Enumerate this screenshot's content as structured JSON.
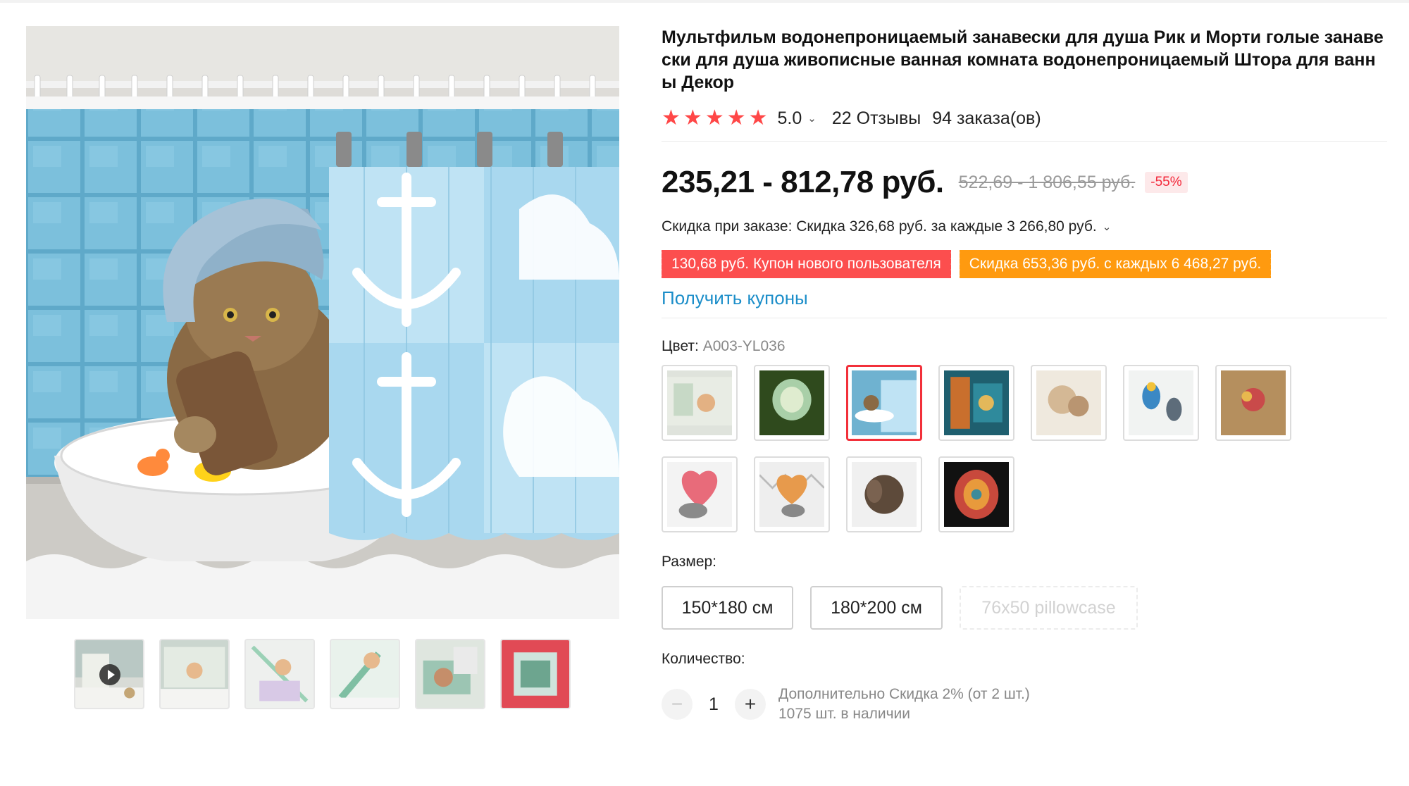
{
  "product": {
    "title": "Мультфильм водонепроницаемый занавески для душа Рик и Морти голые занавески для душа живописные ванная комната водонепроницаемый Штора для ванны Декор"
  },
  "rating": {
    "stars": 5,
    "value": "5.0",
    "reviews": "22 Отзывы",
    "orders": "94 заказа(ов)"
  },
  "price": {
    "current": "235,21 - 812,78 руб.",
    "original": "522,69 - 1 806,55 руб.",
    "discount": "-55%"
  },
  "bulk_discount": "Скидка при заказе: Скидка 326,68 руб. за каждые 3 266,80 руб.",
  "coupons": [
    {
      "label": "130,68 руб. Купон нового пользователя",
      "color": "#fc4e4e"
    },
    {
      "label": "Скидка 653,36 руб. с каждых 6 468,27 руб.",
      "color": "#ff9a0f"
    }
  ],
  "get_coupons_label": "Получить купоны",
  "color_option": {
    "label": "Цвет:",
    "selected": "A003-YL036",
    "swatch_count": 11,
    "selected_index": 2
  },
  "size_option": {
    "label": "Размер:",
    "options": [
      "150*180 см",
      "180*200 см",
      "76x50 pillowcase"
    ],
    "disabled": [
      "76x50 pillowcase"
    ]
  },
  "quantity": {
    "label": "Количество:",
    "value": "1",
    "extra_discount": "Дополнительно Скидка 2% (от 2 шт.)",
    "stock": "1075 шт. в наличии"
  },
  "gallery": {
    "thumbnail_count": 6,
    "video_thumbnail_index": 0
  },
  "colors": {
    "accent_red": "#ff4747",
    "link_blue": "#1c8ec9",
    "coupon_red": "#fc4e4e",
    "coupon_orange": "#ff9a0f"
  }
}
